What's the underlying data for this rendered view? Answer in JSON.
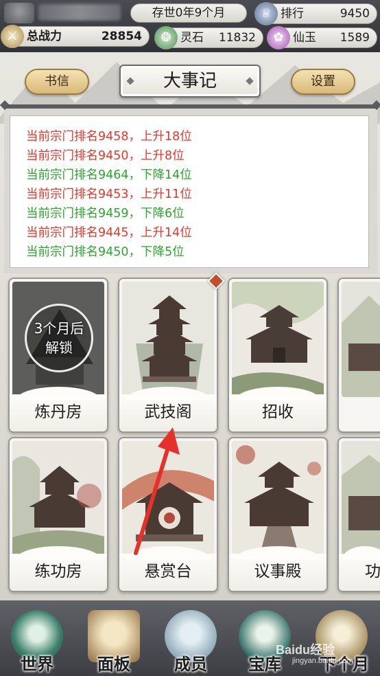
{
  "top_bar": {
    "date": "存世0年9个月",
    "rank": {
      "label": "排行",
      "value": "9450",
      "icon": "rank-icon"
    },
    "power": {
      "label": "总战力",
      "value": "28854",
      "icon": "power-icon"
    },
    "stone": {
      "label": "灵石",
      "value": "11832",
      "icon": "spirit-stone-icon"
    },
    "jade": {
      "label": "仙玉",
      "value": "1589",
      "icon": "immortal-jade-icon"
    }
  },
  "header": {
    "title": "大事记",
    "letter_button": "书信",
    "settings_button": "设置"
  },
  "news": [
    {
      "text": "当前宗门排名9458，上升18位",
      "trend": "up"
    },
    {
      "text": "当前宗门排名9450，上升8位",
      "trend": "up"
    },
    {
      "text": "当前宗门排名9464，下降14位",
      "trend": "down"
    },
    {
      "text": "当前宗门排名9453，上升11位",
      "trend": "up"
    },
    {
      "text": "当前宗门排名9459，下降6位",
      "trend": "down"
    },
    {
      "text": "当前宗门排名9445，上升14位",
      "trend": "up"
    },
    {
      "text": "当前宗门排名9450，下降5位",
      "trend": "down"
    }
  ],
  "buildings": [
    {
      "name": "炼丹房",
      "lock_line1": "3个月后",
      "lock_line2": "解锁"
    },
    {
      "name": "武技阁"
    },
    {
      "name": "招收"
    },
    {
      "name": "练功房"
    },
    {
      "name": "悬赏台"
    },
    {
      "name": "议事殿"
    },
    {
      "name": "功"
    }
  ],
  "bottom_nav": [
    {
      "label": "世界",
      "icon": "world-icon"
    },
    {
      "label": "面板",
      "icon": "panel-scroll-icon"
    },
    {
      "label": "成员",
      "icon": "member-icon"
    },
    {
      "label": "宝库",
      "icon": "treasury-icon"
    },
    {
      "label": "下个月",
      "icon": "next-month-icon"
    }
  ],
  "watermark": {
    "main": "Baidu经验",
    "sub": "jingyan.baidu.com"
  },
  "colors": {
    "up": "#e8362a",
    "down": "#2aa52c",
    "gold_button": "#d9b97a",
    "arrow": "#e8302a"
  }
}
